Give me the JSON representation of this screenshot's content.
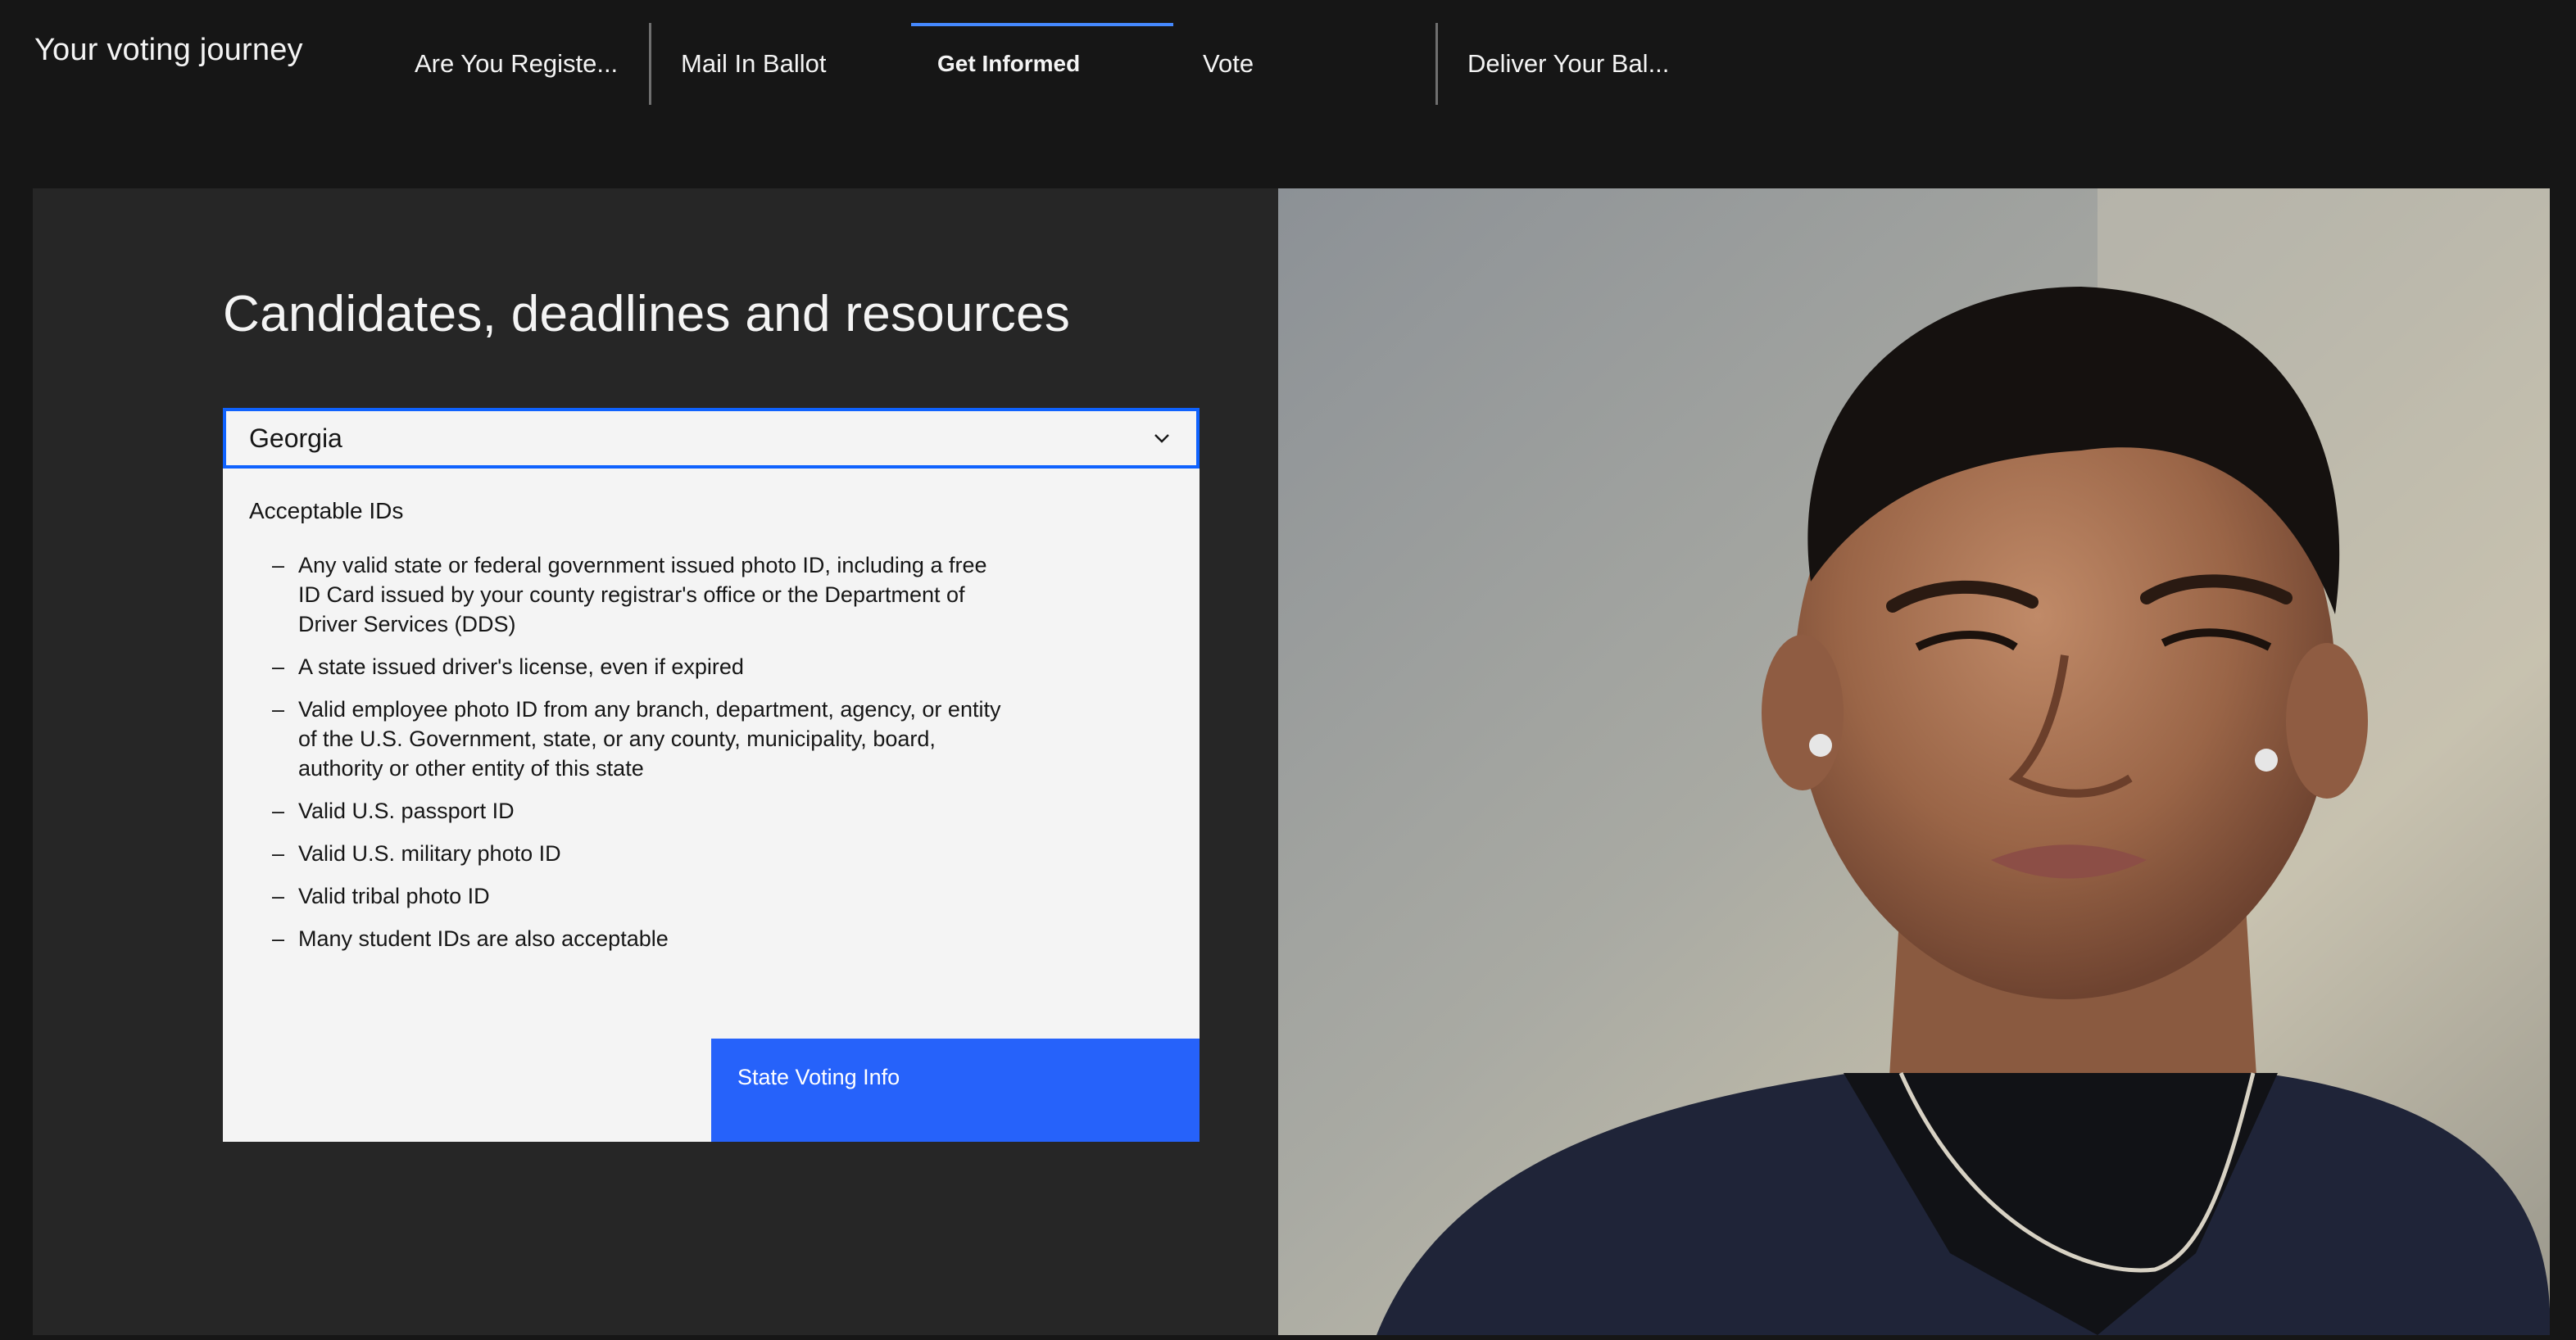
{
  "header": {
    "title": "Your voting journey",
    "tabs": [
      {
        "label": "Are You Registe..."
      },
      {
        "label": "Mail In Ballot"
      },
      {
        "label": "Get Informed"
      },
      {
        "label": "Vote"
      },
      {
        "label": "Deliver Your Bal..."
      }
    ],
    "active_tab": "Get Informed"
  },
  "main": {
    "heading": "Candidates, deadlines and resources",
    "state_select": {
      "value": "Georgia",
      "icon": "chevron-down-icon"
    },
    "ids_heading": "Acceptable IDs",
    "ids": [
      "Any valid state or federal government issued photo ID, including a free ID Card issued by your county registrar's office or the Department of Driver Services (DDS)",
      "A state issued driver's license, even if expired",
      "Valid employee photo ID from any branch, department, agency, or entity of the U.S. Government, state, or any county, municipality, board, authority or other entity of this state",
      "Valid U.S. passport ID",
      "Valid U.S. military photo ID",
      "Valid tribal photo ID",
      "Many student IDs are also acceptable"
    ],
    "info_button_label": "State Voting Info"
  },
  "colors": {
    "background": "#161616",
    "panel": "#262626",
    "accent": "#0f62fe",
    "button": "#2662fa",
    "card": "#f4f4f4"
  }
}
